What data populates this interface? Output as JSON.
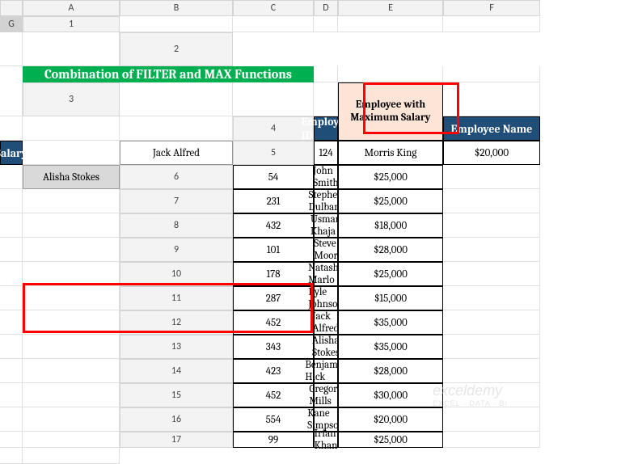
{
  "columns": [
    "A",
    "B",
    "C",
    "D",
    "E",
    "F",
    "G"
  ],
  "rows": [
    "1",
    "2",
    "3",
    "4",
    "5",
    "6",
    "7",
    "8",
    "9",
    "10",
    "11",
    "12",
    "13",
    "14",
    "15",
    "16",
    "17"
  ],
  "title": "Combination of FILTER and MAX Functions",
  "headers": {
    "id": "Employee ID",
    "name": "Employee Name",
    "salary": "Salary"
  },
  "employees": [
    {
      "id": "124",
      "name": "Morris King",
      "salary": "$20,000"
    },
    {
      "id": "54",
      "name": "John Smith",
      "salary": "$25,000"
    },
    {
      "id": "231",
      "name": "Stephen Dulbarg",
      "salary": "$25,000"
    },
    {
      "id": "432",
      "name": "Usman Khaja",
      "salary": "$18,000"
    },
    {
      "id": "101",
      "name": "Steve Moor",
      "salary": "$28,000"
    },
    {
      "id": "178",
      "name": "Natasha Marlo",
      "salary": "$25,000"
    },
    {
      "id": "287",
      "name": "Kyle Johnson",
      "salary": "$15,000"
    },
    {
      "id": "452",
      "name": "Jack Alfred",
      "salary": "$35,000"
    },
    {
      "id": "343",
      "name": "Alisha Stokes",
      "salary": "$35,000"
    },
    {
      "id": "423",
      "name": "Benjamin Hick",
      "salary": "$28,000"
    },
    {
      "id": "452",
      "name": "Gregory Mills",
      "salary": "$30,000"
    },
    {
      "id": "554",
      "name": "Kane Simpson",
      "salary": "$20,000"
    },
    {
      "id": "99",
      "name": "Irfan Khan",
      "salary": "$25,000"
    }
  ],
  "side_label": "Employee with Maximum Salary",
  "results": [
    "Jack Alfred",
    "Alisha Stokes"
  ],
  "watermark": {
    "main": "exceldemy",
    "sub": "EXCEL · DATA · BI"
  }
}
